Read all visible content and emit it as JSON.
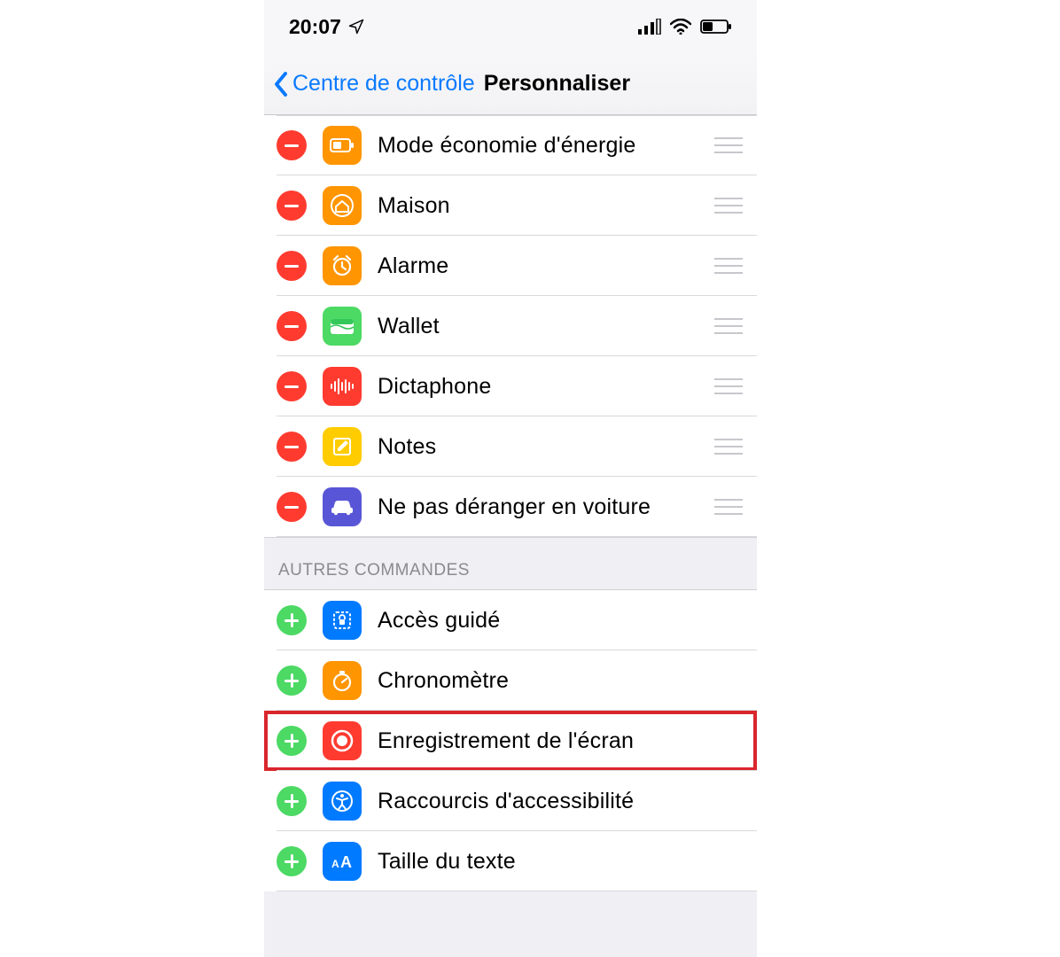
{
  "statusbar": {
    "time": "20:07"
  },
  "nav": {
    "back": "Centre de contrôle",
    "title": "Personnaliser"
  },
  "section_other": "AUTRES COMMANDES",
  "included": [
    {
      "label": "Mode économie d'énergie",
      "icon": "battery"
    },
    {
      "label": "Maison",
      "icon": "home"
    },
    {
      "label": "Alarme",
      "icon": "alarm"
    },
    {
      "label": "Wallet",
      "icon": "wallet"
    },
    {
      "label": "Dictaphone",
      "icon": "waveform"
    },
    {
      "label": "Notes",
      "icon": "notes"
    },
    {
      "label": "Ne pas déranger en voiture",
      "icon": "car"
    }
  ],
  "more": [
    {
      "label": "Accès guidé",
      "icon": "guided"
    },
    {
      "label": "Chronomètre",
      "icon": "stopwatch"
    },
    {
      "label": "Enregistrement de l'écran",
      "icon": "record",
      "highlight": true
    },
    {
      "label": "Raccourcis d'accessibilité",
      "icon": "accessibility"
    },
    {
      "label": "Taille du texte",
      "icon": "textsize"
    }
  ]
}
